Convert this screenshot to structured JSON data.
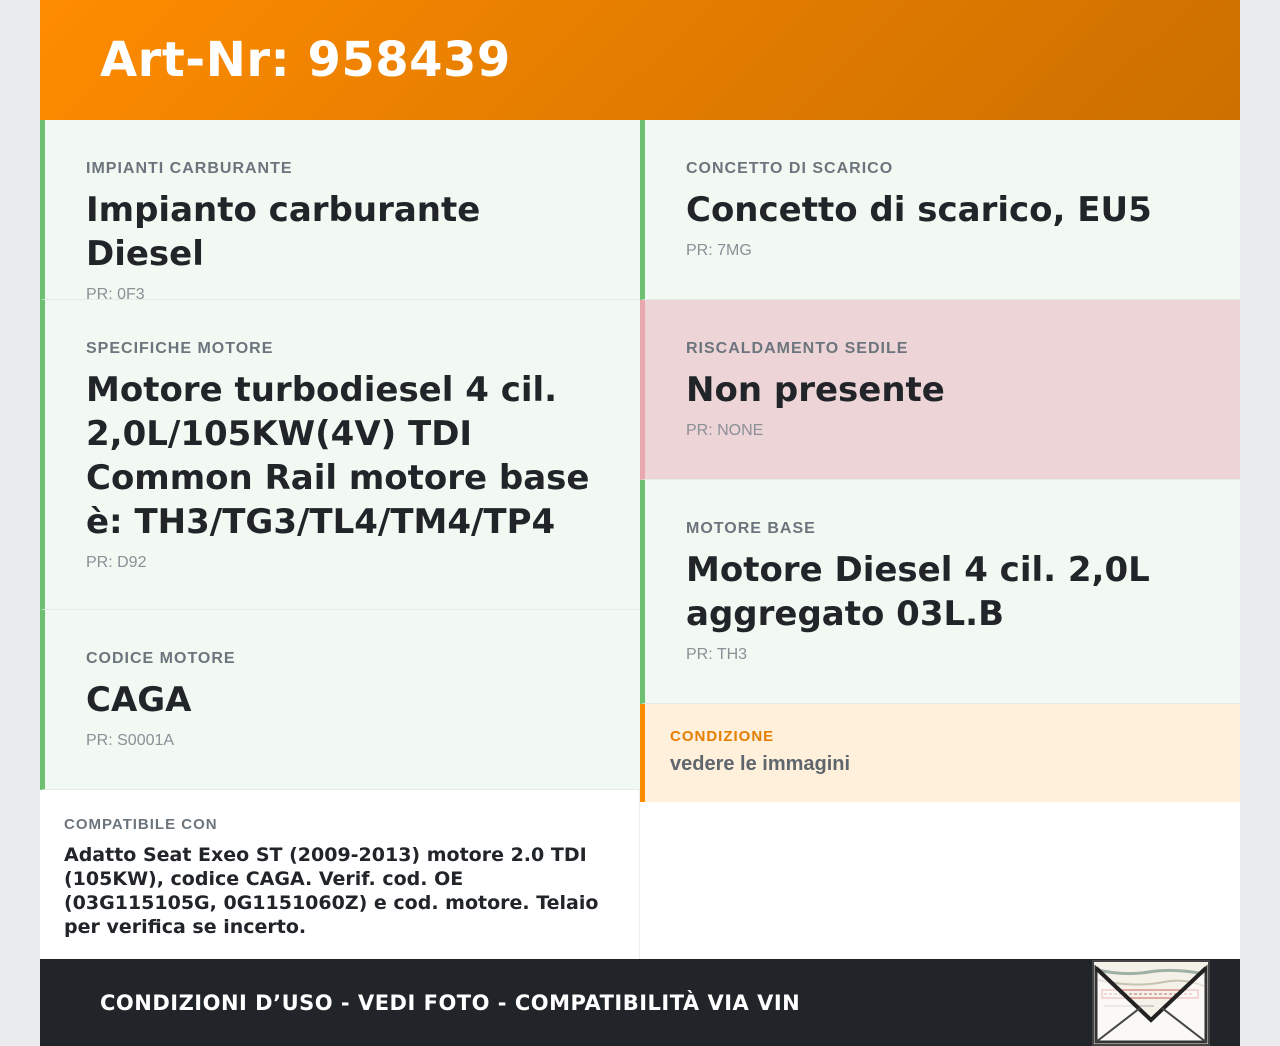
{
  "header": {
    "title": "Art-Nr: 958439"
  },
  "left": [
    {
      "label": "Impianti carburante",
      "value": "Impianto carburante Diesel",
      "pr": "PR: 0F3"
    },
    {
      "label": "Specifiche motore",
      "value": "Motore turbodiesel 4 cil. 2,0L/105KW(4V) TDI Common Rail motore base è: TH3/TG3/TL4/TM4/TP4",
      "pr": "PR: D92"
    },
    {
      "label": "Codice motore",
      "value": "CAGA",
      "pr": "PR: S0001A"
    }
  ],
  "right": [
    {
      "label": "Concetto di scarico",
      "value": "Concetto di scarico, EU5",
      "pr": "PR: 7MG"
    },
    {
      "label": "Riscaldamento sedile",
      "value": "Non presente",
      "pr": "PR: NONE"
    },
    {
      "label": "Motore base",
      "value": "Motore Diesel 4 cil. 2,0L aggregato 03L.B",
      "pr": "PR: TH3"
    }
  ],
  "condition": {
    "label": "Condizione",
    "value": "vedere le immagini"
  },
  "compat": {
    "label": "Compatibile con",
    "text": "Adatto Seat Exeo ST (2009-2013) motore 2.0 TDI (105KW), codice CAGA. Verif. cod. OE (03G115105G, 0G1151060Z) e cod. motore. Telaio per verifica se incerto."
  },
  "footer": {
    "text": "CONDIZIONI D’USO - VEDI FOTO - COMPATIBILITÀ VIA VIN"
  },
  "colors": {
    "accent": "#ff8c00",
    "ok": "#6cc070",
    "missing": "#edd4d6",
    "dark": "#212529"
  }
}
